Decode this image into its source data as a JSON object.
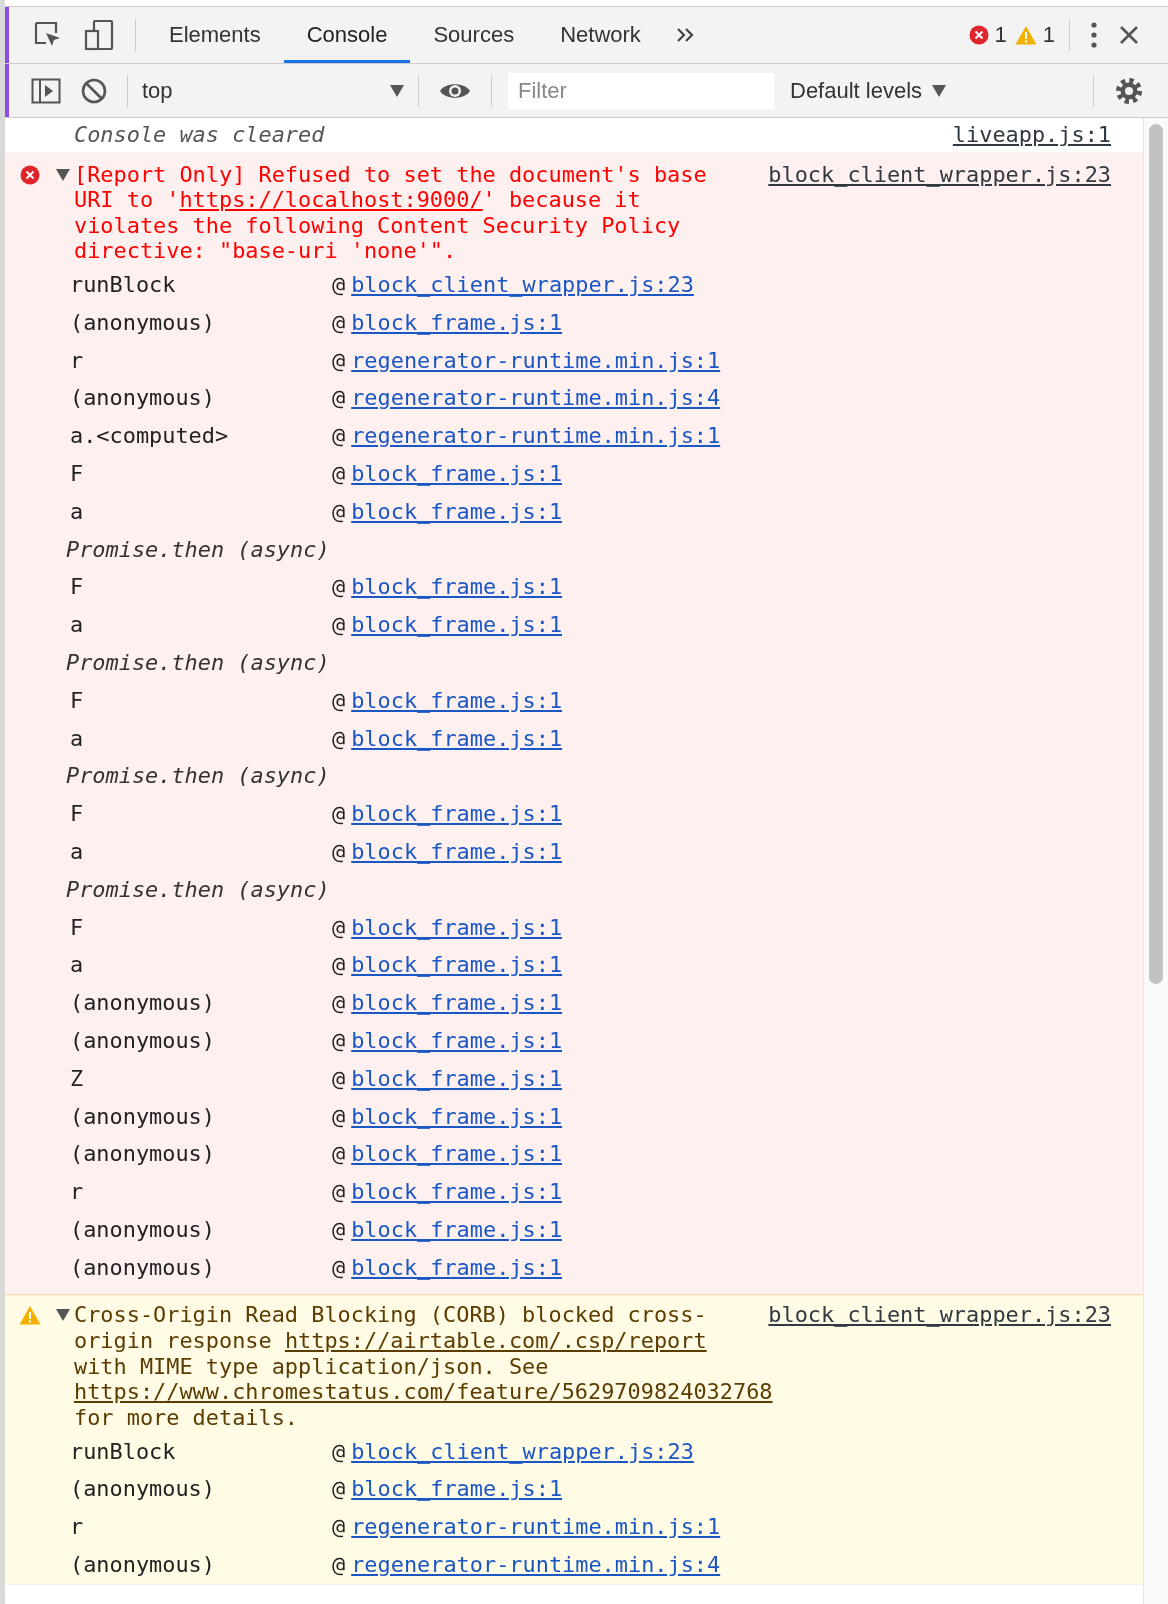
{
  "tabs": [
    {
      "label": "Elements",
      "selected": false
    },
    {
      "label": "Console",
      "selected": true
    },
    {
      "label": "Sources",
      "selected": false
    },
    {
      "label": "Network",
      "selected": false
    }
  ],
  "counts": {
    "errors": "1",
    "warnings": "1"
  },
  "toolbar": {
    "context": "top",
    "filter": {
      "placeholder": "Filter"
    },
    "levels": "Default levels"
  },
  "messages": [
    {
      "kind": "info",
      "parts": [
        {
          "kind": "text",
          "text": "Console was cleared"
        }
      ],
      "source": "liveapp.js:1"
    },
    {
      "kind": "error",
      "expanded": true,
      "parts": [
        {
          "kind": "text",
          "text": "[Report Only] Refused to set the document's base URI to '"
        },
        {
          "kind": "link",
          "text": "https://localhost:9000/"
        },
        {
          "kind": "text",
          "text": "' because it violates the following Content Security Policy directive: \"base-uri 'none'\"."
        }
      ],
      "source": "block_client_wrapper.js:23",
      "stack": [
        {
          "kind": "frame",
          "function": "runBlock",
          "at": "@",
          "source": "block_client_wrapper.js:23"
        },
        {
          "kind": "frame",
          "function": "(anonymous)",
          "at": "@",
          "source": "block_frame.js:1"
        },
        {
          "kind": "frame",
          "function": "r",
          "at": "@",
          "source": "regenerator-runtime.min.js:1"
        },
        {
          "kind": "frame",
          "function": "(anonymous)",
          "at": "@",
          "source": "regenerator-runtime.min.js:4"
        },
        {
          "kind": "frame",
          "function": "a.<computed>",
          "at": "@",
          "source": "regenerator-runtime.min.js:1"
        },
        {
          "kind": "frame",
          "function": "F",
          "at": "@",
          "source": "block_frame.js:1"
        },
        {
          "kind": "frame",
          "function": "a",
          "at": "@",
          "source": "block_frame.js:1"
        },
        {
          "kind": "async",
          "text": "Promise.then (async)"
        },
        {
          "kind": "frame",
          "function": "F",
          "at": "@",
          "source": "block_frame.js:1"
        },
        {
          "kind": "frame",
          "function": "a",
          "at": "@",
          "source": "block_frame.js:1"
        },
        {
          "kind": "async",
          "text": "Promise.then (async)"
        },
        {
          "kind": "frame",
          "function": "F",
          "at": "@",
          "source": "block_frame.js:1"
        },
        {
          "kind": "frame",
          "function": "a",
          "at": "@",
          "source": "block_frame.js:1"
        },
        {
          "kind": "async",
          "text": "Promise.then (async)"
        },
        {
          "kind": "frame",
          "function": "F",
          "at": "@",
          "source": "block_frame.js:1"
        },
        {
          "kind": "frame",
          "function": "a",
          "at": "@",
          "source": "block_frame.js:1"
        },
        {
          "kind": "async",
          "text": "Promise.then (async)"
        },
        {
          "kind": "frame",
          "function": "F",
          "at": "@",
          "source": "block_frame.js:1"
        },
        {
          "kind": "frame",
          "function": "a",
          "at": "@",
          "source": "block_frame.js:1"
        },
        {
          "kind": "frame",
          "function": "(anonymous)",
          "at": "@",
          "source": "block_frame.js:1"
        },
        {
          "kind": "frame",
          "function": "(anonymous)",
          "at": "@",
          "source": "block_frame.js:1"
        },
        {
          "kind": "frame",
          "function": "Z",
          "at": "@",
          "source": "block_frame.js:1"
        },
        {
          "kind": "frame",
          "function": "(anonymous)",
          "at": "@",
          "source": "block_frame.js:1"
        },
        {
          "kind": "frame",
          "function": "(anonymous)",
          "at": "@",
          "source": "block_frame.js:1"
        },
        {
          "kind": "frame",
          "function": "r",
          "at": "@",
          "source": "block_frame.js:1"
        },
        {
          "kind": "frame",
          "function": "(anonymous)",
          "at": "@",
          "source": "block_frame.js:1"
        },
        {
          "kind": "frame",
          "function": "(anonymous)",
          "at": "@",
          "source": "block_frame.js:1"
        }
      ]
    },
    {
      "kind": "warning",
      "expanded": true,
      "parts": [
        {
          "kind": "text",
          "text": "Cross-Origin Read Blocking (CORB) blocked cross-origin response "
        },
        {
          "kind": "link",
          "text": "https://airtable.com/.csp/report"
        },
        {
          "kind": "text",
          "text": " with MIME type application/json. See "
        },
        {
          "kind": "link",
          "text": "https://www.chromestatus.com/feature/5629709824032768"
        },
        {
          "kind": "text",
          "text": " for more details."
        }
      ],
      "source": "block_client_wrapper.js:23",
      "stack": [
        {
          "kind": "frame",
          "function": "runBlock",
          "at": "@",
          "source": "block_client_wrapper.js:23"
        },
        {
          "kind": "frame",
          "function": "(anonymous)",
          "at": "@",
          "source": "block_frame.js:1"
        },
        {
          "kind": "frame",
          "function": "r",
          "at": "@",
          "source": "regenerator-runtime.min.js:1"
        },
        {
          "kind": "frame",
          "function": "(anonymous)",
          "at": "@",
          "source": "regenerator-runtime.min.js:4"
        }
      ]
    }
  ]
}
